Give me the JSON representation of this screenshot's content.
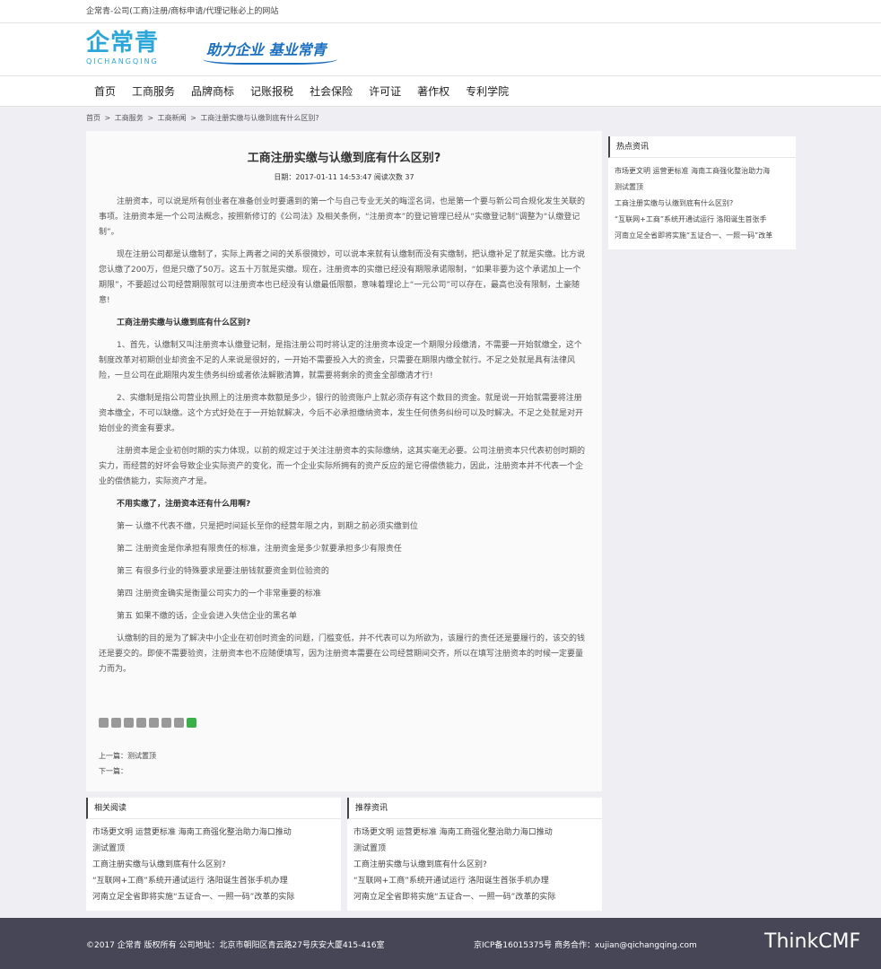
{
  "topbar": {
    "text": "企常青-公司(工商)注册/商标申请/代理记账必上的网站"
  },
  "logo": {
    "cn": "企常青",
    "en": "QICHANGQING"
  },
  "slogan": "助力企业 基业常青",
  "nav": [
    "首页",
    "工商服务",
    "品牌商标",
    "记账报税",
    "社会保险",
    "许可证",
    "著作权",
    "专利学院"
  ],
  "breadcrumb": [
    "首页",
    ">",
    "工商服务",
    ">",
    "工商新闻",
    ">",
    "工商注册实缴与认缴到底有什么区别?"
  ],
  "article": {
    "title": "工商注册实缴与认缴到底有什么区别?",
    "meta": "日期：2017-01-11 14:53:47 阅读次数 37",
    "paragraphs": [
      {
        "text": "注册资本，可以说是所有创业者在准备创业时要遇到的第一个与自己专业无关的晦涩名词，也是第一个要与新公司合规化发生关联的事项。注册资本是一个公司法概念，按照新修订的《公司法》及相关条例，“注册资本”的登记管理已经从“实缴登记制”调整为“认缴登记制”。",
        "strong": false
      },
      {
        "text": "现在注册公司都是认缴制了，实际上两者之间的关系很微妙，可以说本来就有认缴制而没有实缴制，把认缴补足了就是实缴。比方说您认缴了200万，但是只缴了50万。这五十万就是实缴。现在，注册资本的实缴已经没有期限承诺限制，“如果非要为这个承诺加上一个期限”，不要超过公司经营期限就可以注册资本也已经没有认缴最低限额，意味着理论上“一元公司”可以存在，最高也没有限制，土豪随意!",
        "strong": false
      },
      {
        "text": "工商注册实缴与认缴到底有什么区别?",
        "strong": true
      },
      {
        "text": "1、首先，认缴制又叫注册资本认缴登记制，是指注册公司时将认定的注册资本设定一个期限分段缴清，不需要一开始就缴全，这个制度改革对初期创业却资金不足的人来说是很好的，一开始不需要投入大的资金，只需要在期限内缴全就行。不足之处就是具有法律风险，一旦公司在此期限内发生债务纠纷或者依法解散清算，就需要将剩余的资金全部缴清才行!",
        "strong": false
      },
      {
        "text": "2、实缴制是指公司营业执照上的注册资本数额是多少，银行的验资账户上就必须存有这个数目的资金。就是说一开始就需要将注册资本缴全，不可以缺缴。这个方式好处在于一开始就解决，今后不必承担缴纳资本，发生任何债务纠纷可以及时解决。不足之处就是对开始创业的资金有要求。",
        "strong": false
      },
      {
        "text": "注册资本是企业初创时期的实力体现，以前的规定过于关注注册资本的实际缴纳，这其实毫无必要。公司注册资本只代表初创时期的实力，而经营的好坏会导致企业实际资产的变化，而一个企业实际所拥有的资产反应的是它得偿债能力，因此，注册资本并不代表一个企业的偿债能力，实际资产才是。",
        "strong": false
      },
      {
        "text": "不用实缴了，注册资本还有什么用啊?",
        "strong": true
      },
      {
        "text": "第一 认缴不代表不缴，只是把时间延长至你的经营年限之内，到期之前必须实缴到位",
        "strong": false
      },
      {
        "text": "第二 注册资金是你承担有限责任的标准，注册资金是多少就要承担多少有限责任",
        "strong": false
      },
      {
        "text": "第三 有很多行业的特殊要求是要注册钱就要资金到位验资的",
        "strong": false
      },
      {
        "text": "第四 注册资金确实是衡量公司实力的一个非常重要的标准",
        "strong": false
      },
      {
        "text": "第五 如果不缴的话，企业会进入失信企业的黑名单",
        "strong": false
      },
      {
        "text": "认缴制的目的是为了解决中小企业在初创时资金的问题，门槛变低，并不代表可以为所欲为，该履行的责任还是要履行的，该交的钱还是要交的。即使不需要验资，注册资本也不应随便填写，因为注册资本需要在公司经营期间交齐，所以在填写注册资本的时候一定要量力而为。",
        "strong": false
      }
    ],
    "share_icons": [
      "plus-icon",
      "star-icon",
      "weibo-icon",
      "pinterest-icon",
      "renren-icon",
      "douban-icon",
      "qzone-icon",
      "wechat-icon"
    ],
    "prev": "上一篇：测试置顶",
    "next": "下一篇："
  },
  "hot": {
    "title": "热点资讯",
    "items": [
      "市场更文明 运营更标准 海南工商强化整治助力海",
      "测试置顶",
      "工商注册实缴与认缴到底有什么区别?",
      "“互联网+工商”系统开通试运行 洛阳诞生首张手",
      "河南立足全省即将实施“五证合一、一照一码”改革"
    ]
  },
  "related": {
    "title": "相关阅读",
    "items": [
      "市场更文明 运营更标准 海南工商强化整治助力海口推动",
      "测试置顶",
      "工商注册实缴与认缴到底有什么区别?",
      "“互联网+工商”系统开通试运行 洛阳诞生首张手机办理",
      "河南立足全省即将实施“五证合一、一照一码”改革的实际"
    ]
  },
  "recommend": {
    "title": "推荐资讯",
    "items": [
      "市场更文明 运营更标准 海南工商强化整治助力海口推动",
      "测试置顶",
      "工商注册实缴与认缴到底有什么区别?",
      "“互联网+工商”系统开通试运行 洛阳诞生首张手机办理",
      "河南立足全省即将实施“五证合一、一照一码”改革的实际"
    ]
  },
  "footer": {
    "copy": "©2017  企常青  版权所有 公司地址：北京市朝阳区青云路27号庆安大厦415-416室",
    "icp": "京ICP备16015375号 商务合作：xujian@qichangqing.com",
    "brand": "ThinkCMF"
  }
}
